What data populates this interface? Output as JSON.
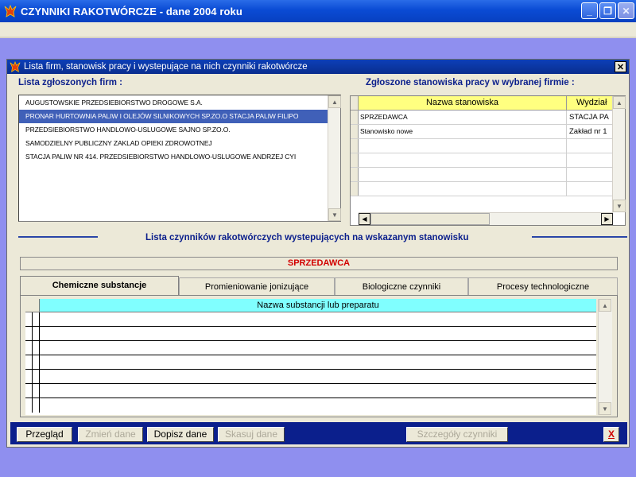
{
  "window": {
    "title": "CZYNNIKI RAKOTWÓRCZE  - dane 2004 roku",
    "controls": {
      "minimize": "_",
      "restore": "❐",
      "close": "✕"
    }
  },
  "dialog": {
    "title": "Lista firm, stanowisk pracy  i wystepujące na nich czynniki rakotwórcze",
    "close": "✕"
  },
  "firms": {
    "label": "Lista zgłoszonych firm :",
    "items": [
      "AUGUSTOWSKIE PRZEDSIEBIORSTWO DROGOWE S.A.",
      "PRONAR HURTOWNIA PALIW I OLEJÓW SILNIKOWYCH SP.ZO.O STACJA PALIW FILIPO",
      "PRZEDSIEBIORSTWO HANDLOWO-USLUGOWE SAJNO SP.ZO.O.",
      "SAMODZIELNY PUBLICZNY ZAKLAD OPIEKI ZDROWOTNEJ",
      "STACJA PALIW NR 414. PRZEDSIEBIORSTWO  HANDLOWO-USLUGOWE ANDRZEJ CYI"
    ],
    "selected_index": 1
  },
  "positions": {
    "label": "Zgłoszone stanowiska pracy w wybranej firmie :",
    "columns": [
      "Nazwa stanowiska",
      "Wydział"
    ],
    "rows": [
      [
        "SPRZEDAWCA",
        "STACJA PA"
      ],
      [
        "Stanowisko nowe",
        "Zakład nr 1"
      ]
    ]
  },
  "factors": {
    "label": "Lista czynników rakotwórczych wystepujących na wskazanym stanowisku",
    "current_position": "SPRZEDAWCA",
    "tabs": [
      "Chemiczne substancje",
      "Promieniowanie jonizujące",
      "Biologiczne czynniki",
      "Procesy technologiczne"
    ],
    "active_tab": 0,
    "table_header": "Nazwa substancji lub preparatu"
  },
  "buttons": {
    "browse": "Przegląd",
    "edit": "Zmień dane",
    "add": "Dopisz dane",
    "delete": "Skasuj dane",
    "details": "Szczegóły czynniki",
    "close": "X"
  },
  "colors": {
    "desktop": "#8f8fef",
    "accent": "#0b1f8c",
    "highlight": "#ffff80",
    "grid_header": "#80ffff",
    "alert": "#d20000"
  }
}
